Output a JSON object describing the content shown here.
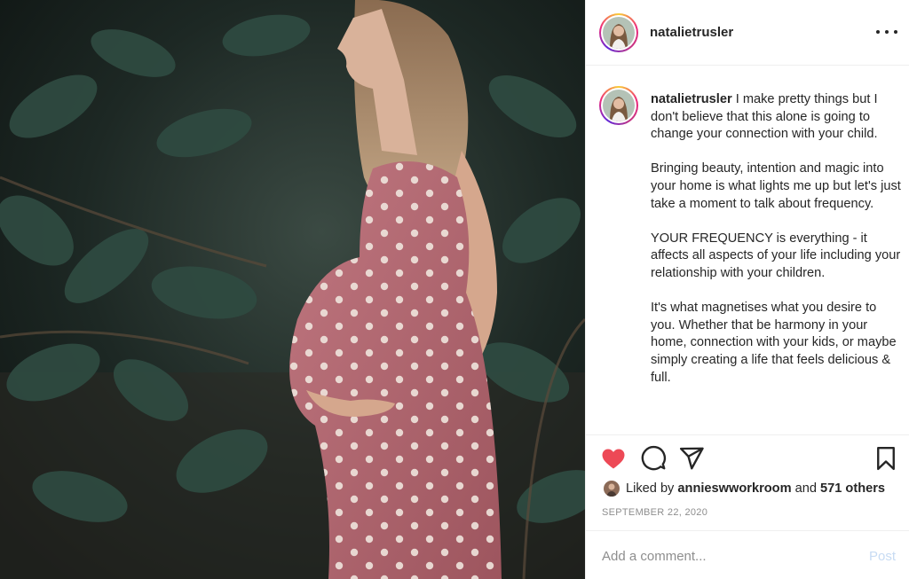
{
  "post": {
    "username": "natalietrusler",
    "caption_username": "natalietrusler",
    "caption_paragraphs": [
      "I make pretty things but I don't believe that this alone is going to change your connection with your child.",
      "Bringing beauty, intention and magic into your home is what lights me up but let's just take a moment to talk about frequency.",
      "YOUR FREQUENCY is everything - it affects all aspects of your life including your relationship with your children.",
      "It's what magnetises what you desire to you. Whether that be harmony in your home, connection with your kids, or maybe simply creating a life that feels delicious & full."
    ],
    "likes": {
      "prefix": "Liked by ",
      "liker": "annieswworkroom",
      "middle": " and ",
      "others": "571 others"
    },
    "date": "SEPTEMBER 22, 2020",
    "liked": true
  },
  "comment": {
    "placeholder": "Add a comment...",
    "post_label": "Post"
  },
  "icons": {
    "more": "more-horizontal-icon",
    "like": "heart-filled-icon",
    "comment": "comment-bubble-icon",
    "share": "paper-plane-icon",
    "save": "bookmark-icon"
  },
  "colors": {
    "heart": "#ed4956",
    "text": "#262626",
    "muted": "#8e8e8e",
    "post_disabled": "#c7dbf3",
    "dress": "#b86b72"
  }
}
